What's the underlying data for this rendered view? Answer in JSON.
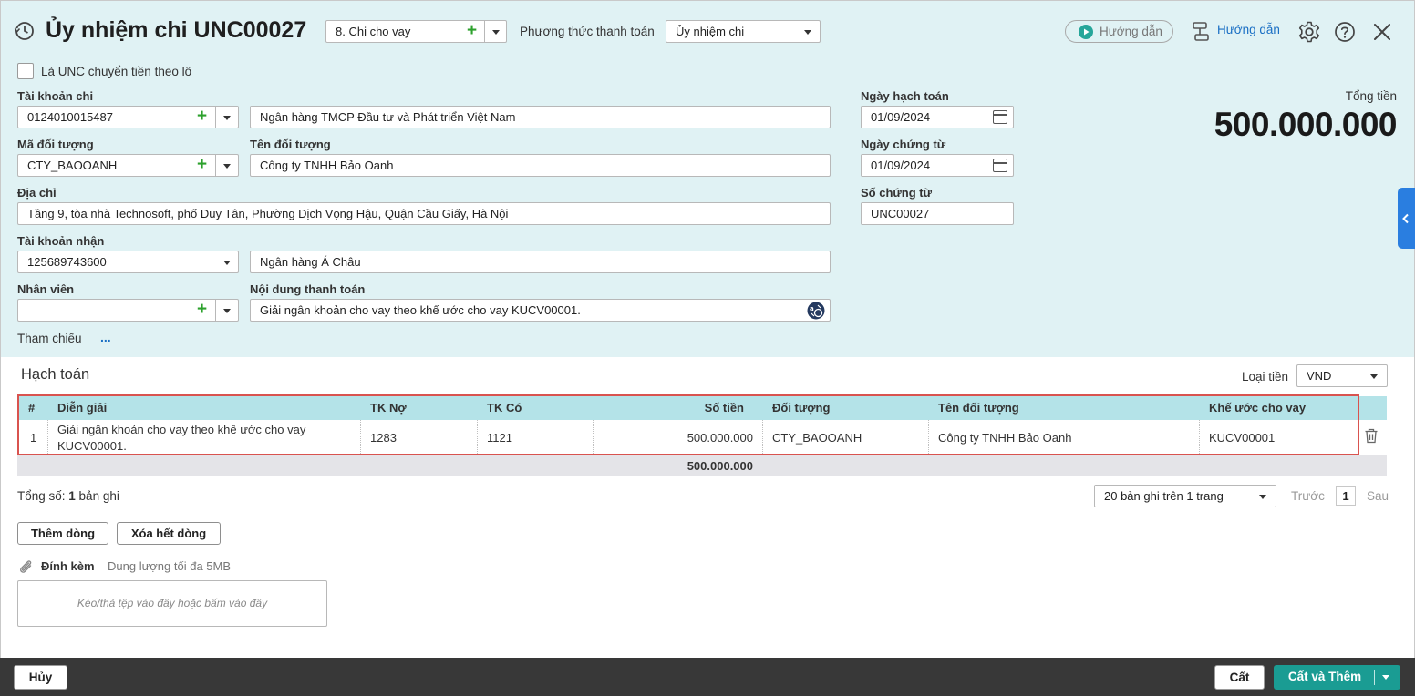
{
  "header": {
    "title": "Ủy nhiệm chi UNC00027",
    "type_value": "8. Chi cho vay",
    "payment_method_label": "Phương thức thanh toán",
    "payment_method_value": "Ủy nhiệm chi",
    "guide_pill_label": "Hướng dẫn",
    "guide_link_label": "Hướng dẫn"
  },
  "batch_checkbox_label": "Là UNC chuyển tiền theo lô",
  "form": {
    "tk_chi_label": "Tài khoản chi",
    "tk_chi_value": "0124010015487",
    "bank_chi_value": "Ngân hàng TMCP Đầu tư và Phát triển Việt Nam",
    "ma_dt_label": "Mã đối tượng",
    "ma_dt_value": "CTY_BAOOANH",
    "ten_dt_label": "Tên đối tượng",
    "ten_dt_value": "Công ty TNHH Bảo Oanh",
    "dia_chi_label": "Địa chỉ",
    "dia_chi_value": "Tầng 9, tòa nhà Technosoft, phố Duy Tân, Phường Dịch Vọng Hậu, Quận Cầu Giấy, Hà Nội",
    "tk_nhan_label": "Tài khoản nhận",
    "tk_nhan_value": "125689743600",
    "bank_nhan_value": "Ngân hàng Á Châu",
    "nhan_vien_label": "Nhân viên",
    "nhan_vien_value": "",
    "noi_dung_label": "Nội dung thanh toán",
    "noi_dung_value": "Giải ngân khoản cho vay theo khế ước cho vay KUCV00001.",
    "tham_chieu_label": "Tham chiếu",
    "tham_chieu_more": "..."
  },
  "dates": {
    "ngay_hach_toan_label": "Ngày hạch toán",
    "ngay_hach_toan_value": "01/09/2024",
    "ngay_chung_tu_label": "Ngày chứng từ",
    "ngay_chung_tu_value": "01/09/2024",
    "so_chung_tu_label": "Số chứng từ",
    "so_chung_tu_value": "UNC00027"
  },
  "total": {
    "label": "Tổng tiền",
    "value": "500.000.000"
  },
  "accounting": {
    "section_title": "Hạch toán",
    "currency_label": "Loại tiền",
    "currency_value": "VND",
    "columns": [
      "#",
      "Diễn giải",
      "TK Nợ",
      "TK Có",
      "Số tiền",
      "Đối tượng",
      "Tên đối tượng",
      "Khế ước cho vay"
    ],
    "rows": [
      {
        "no": "1",
        "dien_giai_line1": "Giải ngân khoản cho vay theo khế ước cho vay",
        "dien_giai_line2": "KUCV00001.",
        "tk_no": "1283",
        "tk_co": "1121",
        "so_tien": "500.000.000",
        "doi_tuong": "CTY_BAOOANH",
        "ten_doi_tuong": "Công ty TNHH Bảo Oanh",
        "khe_uoc": "KUCV00001"
      }
    ],
    "sum_value": "500.000.000"
  },
  "pager": {
    "total_prefix": "Tổng số: ",
    "total_count": "1",
    "total_suffix": " bản ghi",
    "page_size_value": "20 bản ghi trên 1 trang",
    "prev_label": "Trước",
    "current_page": "1",
    "next_label": "Sau"
  },
  "row_buttons": {
    "add_row": "Thêm dòng",
    "clear_rows": "Xóa hết dòng"
  },
  "attachment": {
    "label": "Đính kèm",
    "size_hint": "Dung lượng tối đa 5MB",
    "dropzone_text": "Kéo/thả tệp vào đây hoặc bấm vào đây"
  },
  "footer": {
    "cancel_label": "Hủy",
    "save_label": "Cất",
    "save_add_label": "Cất và Thêm"
  },
  "colors": {
    "header_bg": "#e0f2f4",
    "grid_header_bg": "#b4e3e8",
    "highlight_border": "#d9534f",
    "primary_button": "#1a9c93",
    "footer_bg": "#383838",
    "plus_green": "#2da12d",
    "link_blue": "#1a6fc4"
  },
  "icons": [
    "history-icon",
    "plus-icon",
    "chevron-down-icon",
    "play-icon",
    "guide-icon",
    "gear-icon",
    "help-icon",
    "close-icon",
    "calendar-icon",
    "translate-icon",
    "trash-icon",
    "paperclip-icon",
    "chevron-left-icon"
  ]
}
